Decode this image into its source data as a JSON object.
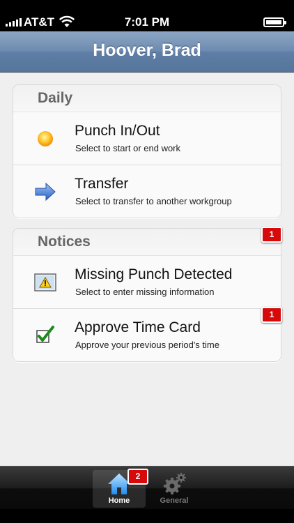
{
  "status": {
    "carrier": "AT&T",
    "time": "7:01 PM"
  },
  "navbar": {
    "title": "Hoover, Brad"
  },
  "daily": {
    "header": "Daily",
    "items": [
      {
        "title": "Punch In/Out",
        "subtitle": "Select to start or end work",
        "icon": "sun-icon"
      },
      {
        "title": "Transfer",
        "subtitle": "Select to transfer to another workgroup",
        "icon": "arrow-right-icon"
      }
    ]
  },
  "notices": {
    "header": "Notices",
    "badge": "1",
    "items": [
      {
        "title": "Missing Punch Detected",
        "subtitle": "Select to enter missing information",
        "icon": "warning-icon"
      },
      {
        "title": "Approve Time Card",
        "subtitle": "Approve your previous period's time",
        "icon": "checkmark-icon",
        "badge": "1"
      }
    ]
  },
  "tabbar": {
    "tabs": [
      {
        "label": "Home",
        "badge": "2",
        "icon": "home-icon",
        "active": true
      },
      {
        "label": "General",
        "icon": "gear-icon",
        "active": false
      }
    ]
  },
  "colors": {
    "navbar": "#6d8bb0",
    "badge": "#d60a0a",
    "background": "#efefef"
  }
}
